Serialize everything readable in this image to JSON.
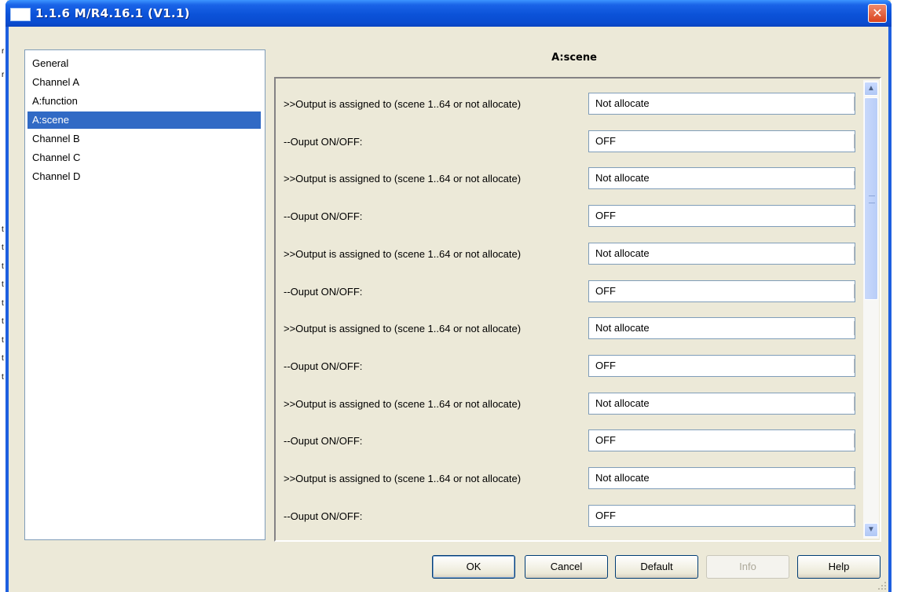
{
  "window": {
    "title": "1.1.6 M/R4.16.1 (V1.1)",
    "close_glyph": "✕"
  },
  "background_fragments": [
    "r",
    "r",
    "t",
    "t",
    "t",
    "t",
    "t",
    "t",
    "t",
    "t",
    "t"
  ],
  "nav": {
    "items": [
      {
        "label": "General",
        "selected": false
      },
      {
        "label": "Channel A",
        "selected": false
      },
      {
        "label": "A:function",
        "selected": false
      },
      {
        "label": "A:scene",
        "selected": true
      },
      {
        "label": "Channel B",
        "selected": false
      },
      {
        "label": "Channel C",
        "selected": false
      },
      {
        "label": "Channel D",
        "selected": false
      }
    ]
  },
  "panel": {
    "title": "A:scene",
    "params": [
      {
        "label": ">>Output is assigned to (scene 1..64 or not allocate)",
        "value": "Not allocate"
      },
      {
        "label": "--Ouput ON/OFF:",
        "value": "OFF"
      },
      {
        "label": ">>Output is assigned to (scene 1..64 or not allocate)",
        "value": "Not allocate"
      },
      {
        "label": "--Ouput ON/OFF:",
        "value": "OFF"
      },
      {
        "label": ">>Output is assigned to (scene 1..64 or not allocate)",
        "value": "Not allocate"
      },
      {
        "label": "--Ouput ON/OFF:",
        "value": "OFF"
      },
      {
        "label": ">>Output is assigned to (scene 1..64 or not allocate)",
        "value": "Not allocate"
      },
      {
        "label": "--Ouput ON/OFF:",
        "value": "OFF"
      },
      {
        "label": ">>Output is assigned to (scene 1..64 or not allocate)",
        "value": "Not allocate"
      },
      {
        "label": "--Ouput ON/OFF:",
        "value": "OFF"
      },
      {
        "label": ">>Output is assigned to (scene 1..64 or not allocate)",
        "value": "Not allocate"
      },
      {
        "label": "--Ouput ON/OFF:",
        "value": "OFF"
      }
    ],
    "scroll_up_glyph": "▲",
    "scroll_down_glyph": "▼"
  },
  "buttons": {
    "ok": "OK",
    "cancel": "Cancel",
    "default": "Default",
    "info": "Info",
    "help": "Help"
  }
}
